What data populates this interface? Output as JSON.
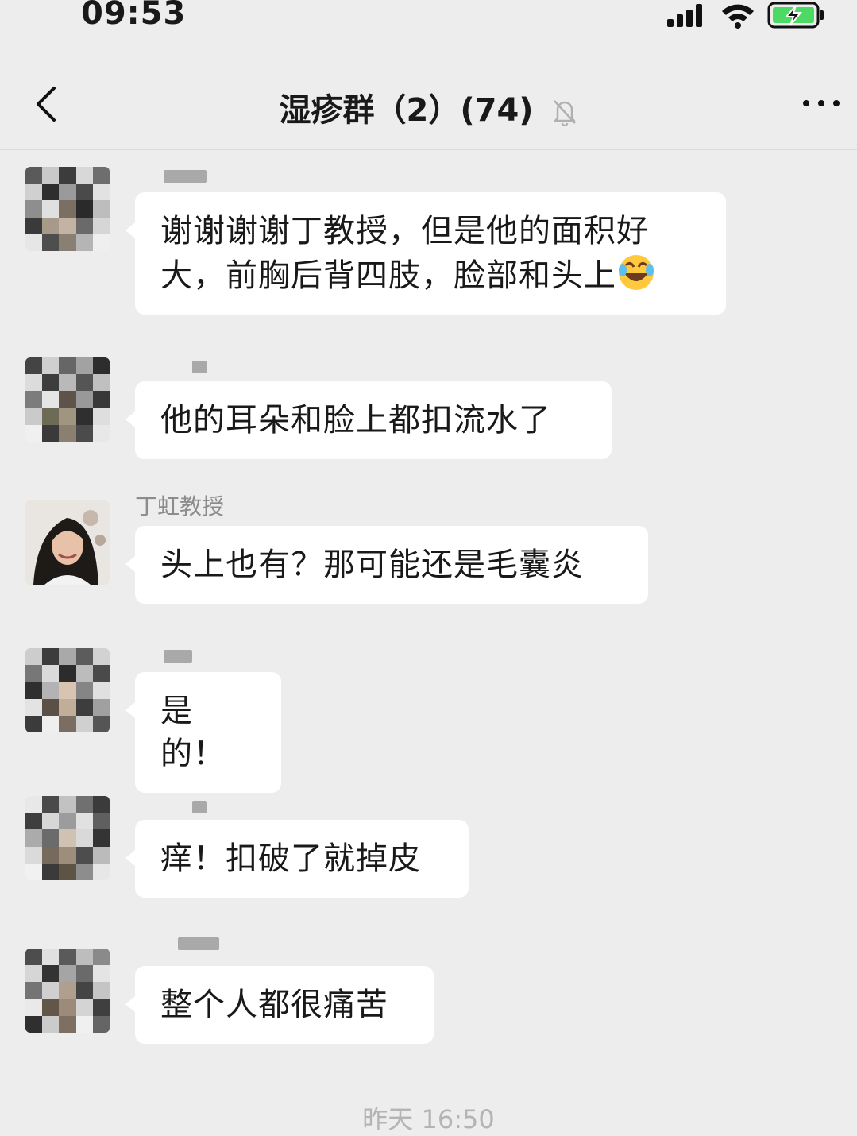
{
  "status_bar": {
    "time": "09:53",
    "icons": [
      "signal-icon",
      "wifi-icon",
      "battery-charging-icon"
    ]
  },
  "nav": {
    "back_icon": "chevron-left-icon",
    "title": "湿疹群（2）(74)",
    "mute_icon": "bell-muted-icon",
    "more_icon": "more-icon"
  },
  "messages": [
    {
      "sender": "",
      "text": "谢谢谢谢丁教授，但是他的面积好大，前胸后背四肢，脸部和头上",
      "emoji": "rofl-emoji"
    },
    {
      "sender": "",
      "text": "他的耳朵和脸上都扣流水了"
    },
    {
      "sender": "丁虹教授",
      "text": "头上也有？那可能还是毛囊炎"
    },
    {
      "sender": "",
      "text": "是的！"
    },
    {
      "sender": "",
      "text": "痒！扣破了就掉皮"
    },
    {
      "sender": "",
      "text": "整个人都很痛苦"
    }
  ],
  "footer": {
    "timestamp": "昨天 16:50"
  },
  "colors": {
    "background": "#ededed",
    "bubble": "#ffffff",
    "text": "#191919",
    "meta": "#8c8c8c",
    "battery_green": "#4cd964"
  }
}
